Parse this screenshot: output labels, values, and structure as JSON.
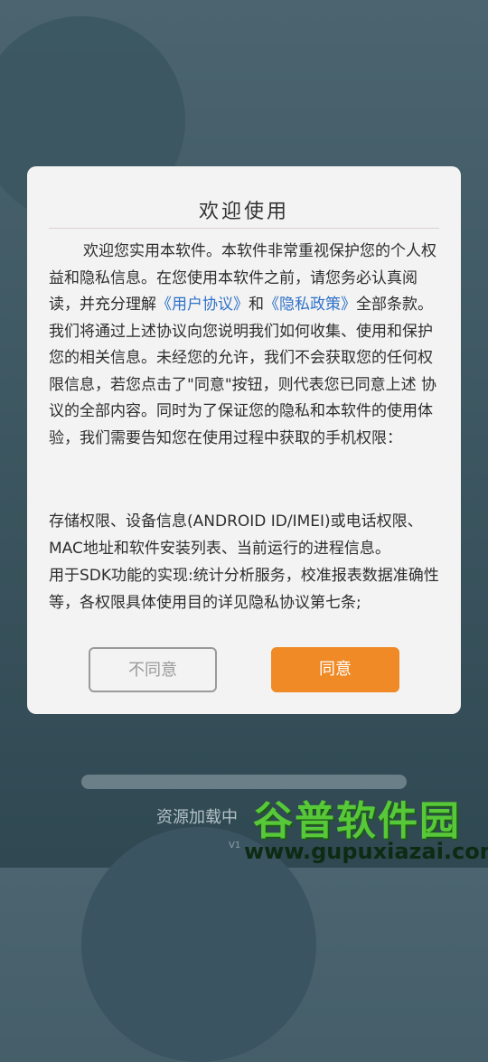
{
  "dialog": {
    "title": "欢迎使用",
    "intro_before_user_link": "欢迎您实用本软件。本软件非常重视保护您的个人权益和隐私信息。在您使用本软件之前，请您务必认真阅读，并充分理解",
    "user_agreement_link": "《用户协议》",
    "and_text": "和",
    "privacy_policy_link": "《隐私政策》",
    "intro_after_links": "全部条款。我们将通过上述协议向您说明我们如何收集、使用和保护您的相关信息。未经您的允许，我们不会获取您的任何权限信息，若您点击了\"同意\"按钮，则代表您已同意上述 协议的全部内容。同时为了保证您的隐私和本软件的使用体验，我们需要告知您在使用过程中获取的手机权限：",
    "permissions_line1": "存储权限、设备信息(ANDROID ID/IMEI)或电话权限、MAC地址和软件安装列表、当前运行的进程信息。",
    "permissions_line2": "用于SDK功能的实现:统计分析服务，校准报表数据准确性等，各权限具体使用目的详见隐私协议第七条;",
    "disagree_label": "不同意",
    "agree_label": "同意"
  },
  "background": {
    "loading_text": "资源加载中",
    "version_text": "V1"
  },
  "watermark": {
    "title": "谷普软件园",
    "url": "www.gupuxiazai.com"
  },
  "colors": {
    "accent": "#ef8a26",
    "link": "#2f72c9"
  }
}
